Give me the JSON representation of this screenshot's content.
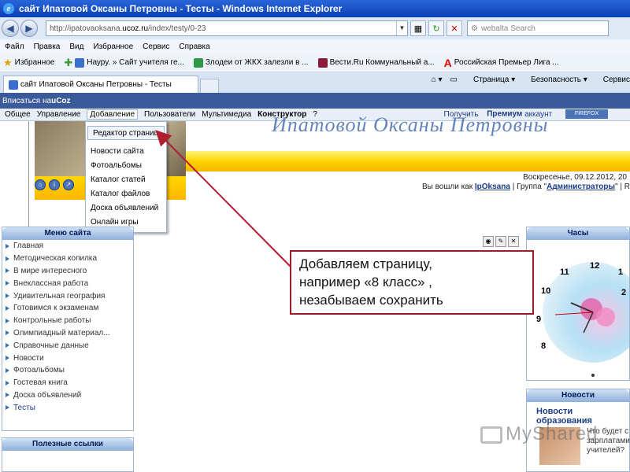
{
  "window": {
    "title": "сайт Ипатовой Оксаны Петровны - Тесты - Windows Internet Explorer"
  },
  "address": {
    "url_prefix": "http://ipatovaoksana.",
    "url_domain": "ucoz.ru",
    "url_suffix": "/index/testy/0-23",
    "search_placeholder": "webalta Search"
  },
  "menubar": [
    "Файл",
    "Правка",
    "Вид",
    "Избранное",
    "Сервис",
    "Справка"
  ],
  "favorites": {
    "label": "Избранное",
    "items": [
      "Науру. » Сайт учителя ге...",
      "Злодеи от ЖКХ залезли в ...",
      "Вести.Ru Коммунальный а...",
      "Российская Премьер Лига ..."
    ]
  },
  "tab": {
    "title": "сайт Ипатовой Оксаны Петровны - Тесты"
  },
  "tabtools": {
    "page": "Страница",
    "safety": "Безопасность",
    "service": "Сервис"
  },
  "ucoz": {
    "login_link": "Вписаться на ",
    "brand": "uCoz",
    "premium_prefix": "Получить ",
    "premium_bold": "Премиум",
    "premium_suffix": " аккаунт",
    "firefox": "FIREFOX",
    "menu": [
      "Общее",
      "Управление",
      "Добавление",
      "Пользователи",
      "Мультимедиа",
      "Конструктор",
      "?"
    ]
  },
  "dropdown": [
    "Редактор страниц",
    "Новости сайта",
    "Фотоальбомы",
    "Каталог статей",
    "Каталог файлов",
    "Доска объявлений",
    "Онлайн игры"
  ],
  "header": {
    "site_title": "Ипатовой Оксаны Петровны",
    "date": "Воскресенье, 09.12.2012, 20",
    "login_prefix": "Вы вошли как ",
    "user": "IpOksana",
    "group_prefix": " | Группа \"",
    "group": "Администраторы",
    "group_suffix": "\" | R"
  },
  "sidebar": {
    "title": "Меню сайта",
    "items": [
      "Главная",
      "Методическая копилка",
      "В мире интересного",
      "Внеклассная работа",
      "Удивительная география",
      "Готовимся к экзаменам",
      "Контрольные работы",
      "Олимпиадный материал...",
      "Справочные данные",
      "Новости",
      "Фотоальбомы",
      "Гостевая книга",
      "Доска объявлений",
      "Тесты"
    ]
  },
  "useful": {
    "title": "Полезные ссылки"
  },
  "clock": {
    "title": "Часы",
    "numbers": [
      "12",
      "11",
      "10",
      "9",
      "8",
      "1",
      "2"
    ]
  },
  "news": {
    "title": "Новости",
    "subtitle": "Новости образования",
    "text": [
      "Что будет с",
      "зарплатами",
      "учителей?"
    ]
  },
  "callout": {
    "lines": [
      "Добавляем страницу,",
      "например «8 класс» ,",
      "незабываем сохранить"
    ]
  },
  "watermark": {
    "text": "MyShared"
  }
}
